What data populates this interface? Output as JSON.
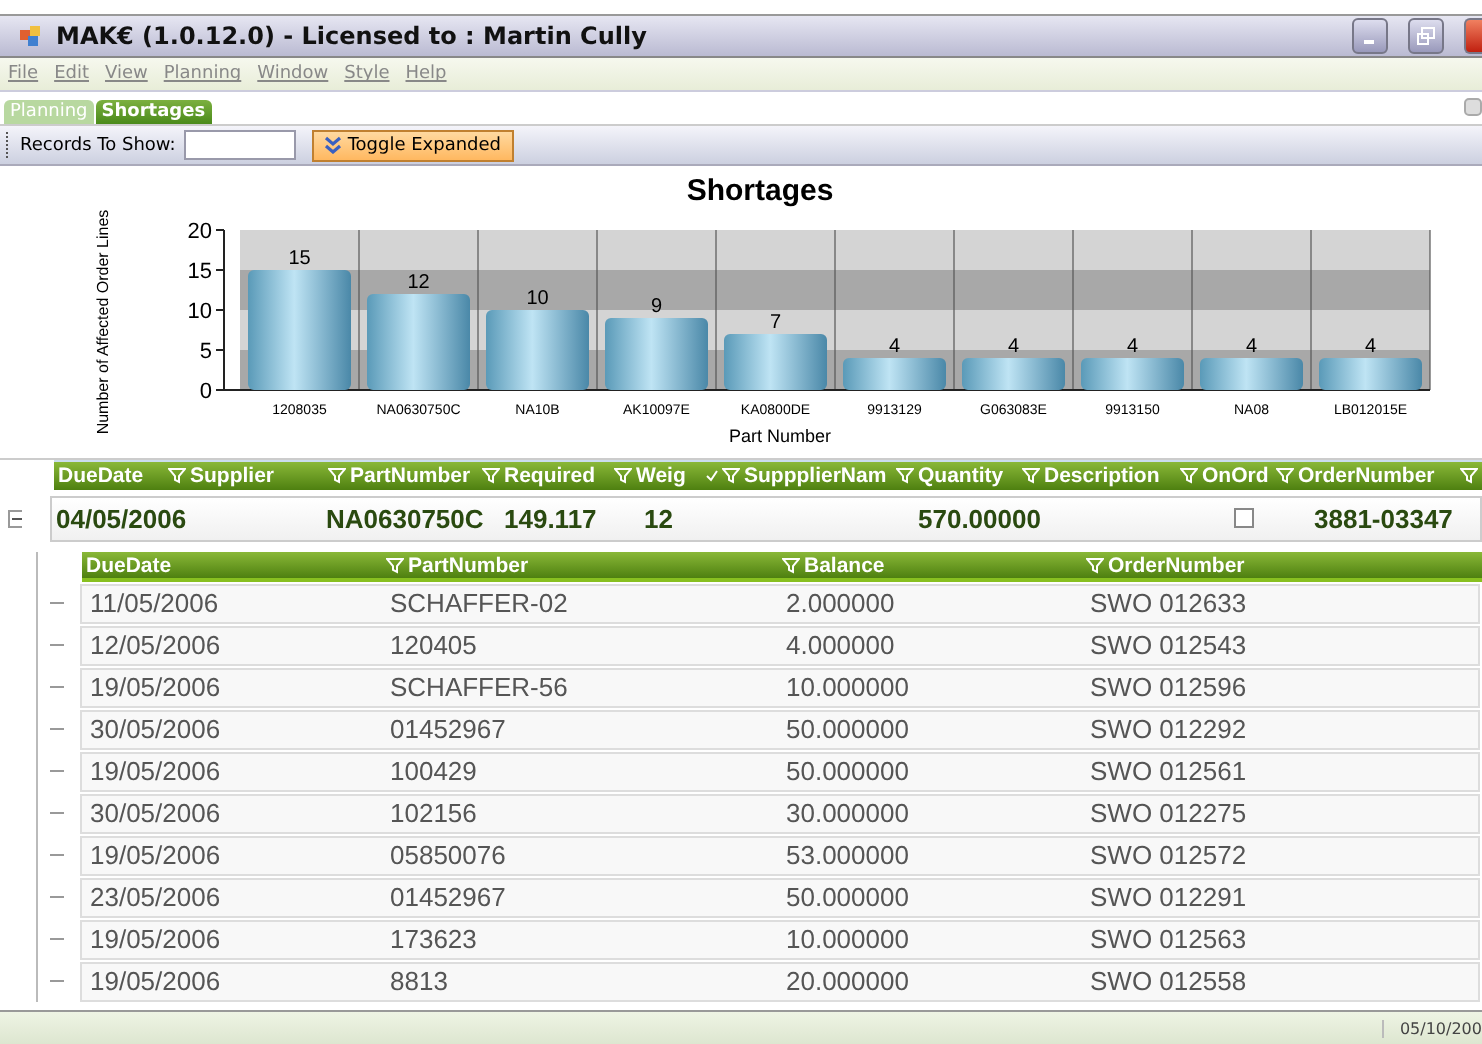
{
  "window": {
    "title": "MAK€ (1.0.12.0) - Licensed to : Martin Cully"
  },
  "menu": [
    "File",
    "Edit",
    "View",
    "Planning",
    "Window",
    "Style",
    "Help"
  ],
  "tabs": [
    {
      "label": "Planning",
      "selected": false
    },
    {
      "label": "Shortages",
      "selected": true
    }
  ],
  "toolbar": {
    "records_label": "Records To Show:",
    "toggle_button": "Toggle Expanded"
  },
  "chart": {
    "chart_data": {
      "type": "bar",
      "title": "Shortages",
      "xlabel": "Part Number",
      "ylabel": "Number of Affected Order Lines",
      "categories": [
        "1208035",
        "NA0630750C",
        "NA10B",
        "AK10097E",
        "KA0800DE",
        "9913129",
        "G063083E",
        "9913150",
        "NA08",
        "LB012015E"
      ],
      "values": [
        15,
        12,
        10,
        9,
        7,
        4,
        4,
        4,
        4,
        4
      ],
      "yticks": [
        0,
        5,
        10,
        15,
        20
      ],
      "ylim": [
        0,
        20
      ],
      "data_labels": true,
      "grid": true
    }
  },
  "master_grid": {
    "columns": [
      {
        "label": "DueDate",
        "filter": false,
        "sorted": false
      },
      {
        "label": "Supplier",
        "filter": true,
        "sorted": false
      },
      {
        "label": "PartNumber",
        "filter": true,
        "sorted": false
      },
      {
        "label": "Required",
        "filter": true,
        "sorted": false
      },
      {
        "label": "Weig",
        "filter": true,
        "sorted": false
      },
      {
        "label": "SuppplierNam",
        "filter": true,
        "sorted": true
      },
      {
        "label": "Quantity",
        "filter": true,
        "sorted": false
      },
      {
        "label": "Description",
        "filter": true,
        "sorted": false
      },
      {
        "label": "OnOrd",
        "filter": true,
        "sorted": false
      },
      {
        "label": "OrderNumber",
        "filter": true,
        "sorted": false
      },
      {
        "filter": true,
        "sorted": false
      }
    ],
    "row": {
      "expanded": true,
      "cells": [
        {
          "kind": "text",
          "value": "04/05/2006"
        },
        {
          "kind": "empty"
        },
        {
          "kind": "text",
          "value": "NA0630750C"
        },
        {
          "kind": "text",
          "value": "149.117"
        },
        {
          "kind": "text",
          "value": "12"
        },
        {
          "kind": "empty"
        },
        {
          "kind": "text",
          "value": "570.00000"
        },
        {
          "kind": "empty"
        },
        {
          "kind": "checkbox",
          "checked": false
        },
        {
          "kind": "text",
          "value": "3881-03347"
        }
      ]
    }
  },
  "detail_grid": {
    "columns": [
      {
        "label": "DueDate",
        "filter": false
      },
      {
        "label": "PartNumber",
        "filter": true
      },
      {
        "label": "Balance",
        "filter": true
      },
      {
        "label": "OrderNumber",
        "filter": true
      }
    ],
    "rows": [
      [
        "11/05/2006",
        "SCHAFFER-02",
        "2.000000",
        "SWO 012633"
      ],
      [
        "12/05/2006",
        "120405",
        "4.000000",
        "SWO 012543"
      ],
      [
        "19/05/2006",
        "SCHAFFER-56",
        "10.000000",
        "SWO 012596"
      ],
      [
        "30/05/2006",
        "01452967",
        "50.000000",
        "SWO 012292"
      ],
      [
        "19/05/2006",
        "100429",
        "50.000000",
        "SWO 012561"
      ],
      [
        "30/05/2006",
        "102156",
        "30.000000",
        "SWO 012275"
      ],
      [
        "19/05/2006",
        "05850076",
        "53.000000",
        "SWO 012572"
      ],
      [
        "23/05/2006",
        "01452967",
        "50.000000",
        "SWO 012291"
      ],
      [
        "19/05/2006",
        "173623",
        "10.000000",
        "SWO 012563"
      ],
      [
        "19/05/2006",
        "8813",
        "20.000000",
        "SWO 012558"
      ]
    ]
  },
  "status_bar": {
    "date": "05/10/200"
  }
}
